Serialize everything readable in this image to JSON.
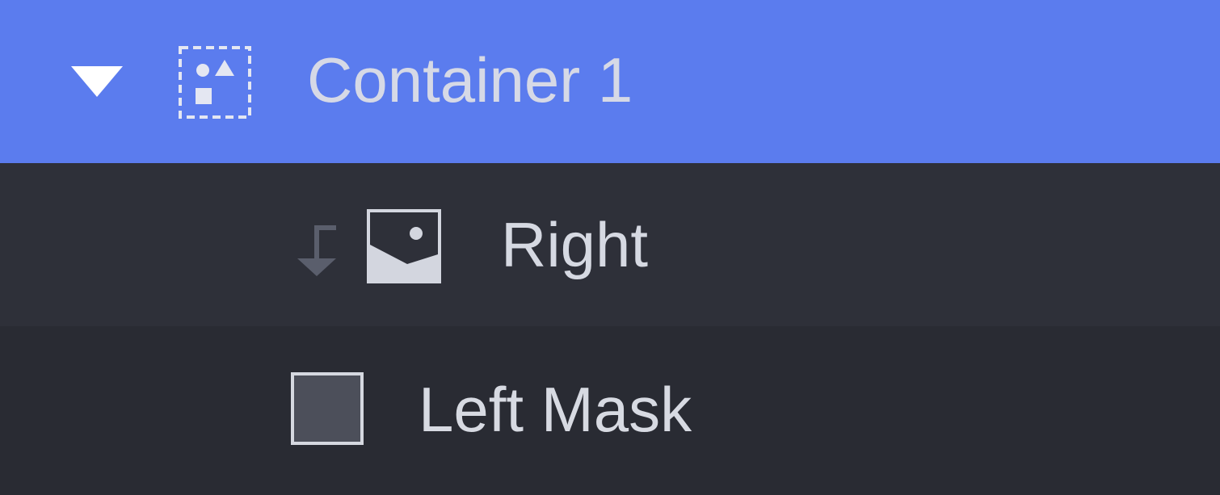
{
  "layers": [
    {
      "label": "Container 1",
      "icon": "container-icon",
      "expander": "caret-down-icon",
      "selected": true
    },
    {
      "label": "Right",
      "icon": "image-icon",
      "indicator": "mask-arrow-icon",
      "selected": false
    },
    {
      "label": "Left Mask",
      "icon": "rectangle-shape-icon",
      "selected": false
    }
  ],
  "colors": {
    "selection": "#5b7cee",
    "row_dark": "#2e3039",
    "row_darker": "#292b33",
    "text": "#d6d9e2"
  }
}
